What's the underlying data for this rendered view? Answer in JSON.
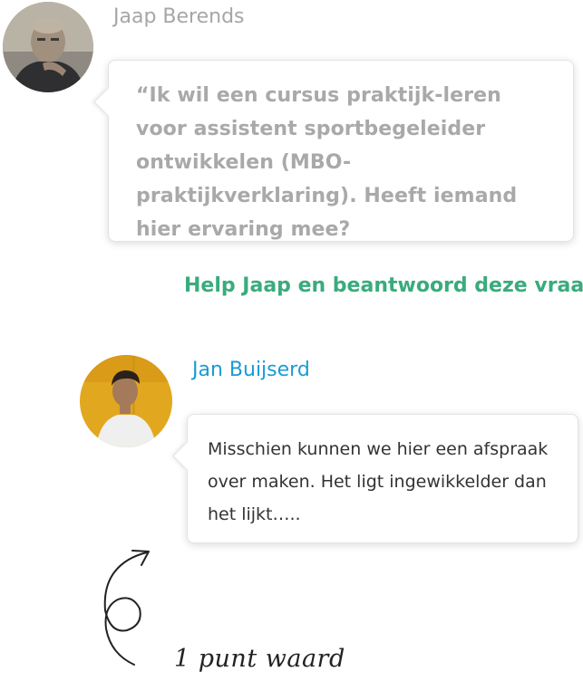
{
  "question": {
    "author_name": "Jaap Berends",
    "text": "“Ik wil een cursus praktijk-leren voor assistent sportbegeleider ontwikkelen (MBO-praktijkverklaring). Heeft iemand hier ervaring mee?"
  },
  "help_link": "Help Jaap en beantwoord deze vraag",
  "answer": {
    "author_name": "Jan Buijserd",
    "text": "Misschien kunnen we hier een afspraak over maken. Het ligt ingewikkelder dan het lijkt….."
  },
  "annotation": {
    "label": "1 punt waard"
  },
  "colors": {
    "question_author": "#a6a6a6",
    "answer_author": "#1a9bd6",
    "help_link": "#3aab7d",
    "question_text": "#a9a9a9",
    "answer_text": "#333333"
  },
  "icons": {
    "jaap_avatar": "avatar-photo",
    "jan_avatar": "avatar-photo",
    "annotation": "curly-arrow-icon"
  }
}
